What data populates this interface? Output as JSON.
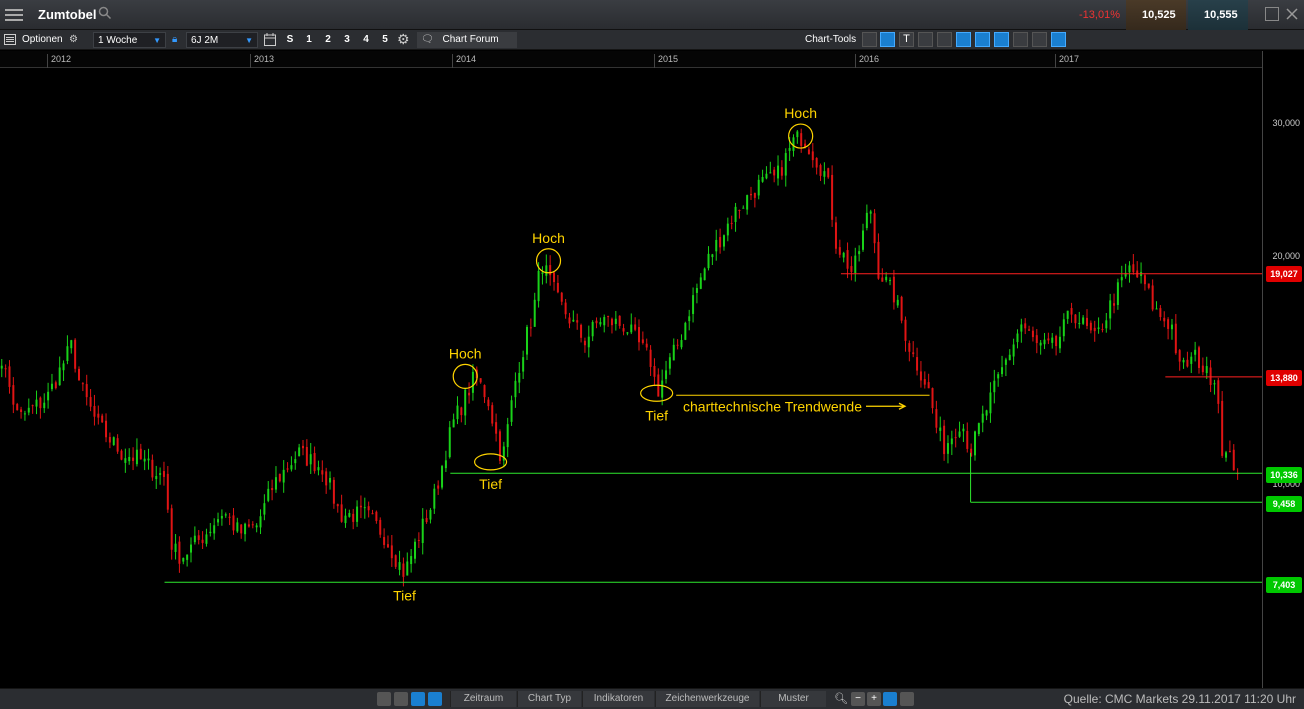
{
  "header": {
    "symbol": "Zumtobel",
    "change_pct": "-13,01%",
    "sell_price": "10,525",
    "buy_price": "10,555"
  },
  "toolbar": {
    "options_label": "Optionen",
    "interval": "1 Woche",
    "range": "6J 2M",
    "s_label": "S",
    "nums": [
      "1",
      "2",
      "3",
      "4",
      "5"
    ],
    "forum_label": "Chart Forum",
    "chart_tools_label": "Chart-Tools"
  },
  "time_axis": {
    "years": [
      "2012",
      "2013",
      "2014",
      "2015",
      "2016",
      "2017"
    ]
  },
  "price_axis": {
    "ticks": [
      "30,000",
      "20,000",
      "10,000"
    ],
    "tags": [
      {
        "label": "19,027",
        "color": "#e00000"
      },
      {
        "label": "13,880",
        "color": "#e00000"
      },
      {
        "label": "10,336",
        "color": "#00c800"
      },
      {
        "label": "9,458",
        "color": "#00c800"
      },
      {
        "label": "7,403",
        "color": "#00c800"
      }
    ]
  },
  "annotations": {
    "hoch": "Hoch",
    "tief": "Tief",
    "trendwende": "charttechnische Trendwende"
  },
  "bottombar": {
    "tabs": [
      "Zeitraum",
      "Chart Typ",
      "Indikatoren",
      "Zeichenwerkzeuge",
      "Muster"
    ],
    "source": "Quelle: CMC Markets 29.11.2017 11:20 Uhr"
  },
  "colors": {
    "up": "#19d219",
    "down": "#e01414",
    "annotation": "#ffd400",
    "support": "#2ee82e",
    "resistance": "#ff2020"
  },
  "chart_data": {
    "type": "candlestick",
    "interval": "1 Woche",
    "x_range": [
      "2011-09",
      "2017-11"
    ],
    "y_scale": "log",
    "ylim": [
      6.4,
      32.2
    ],
    "waypoints": [
      [
        "2011-09-20",
        13.5
      ],
      [
        "2011-10-10",
        14.7
      ],
      [
        "2011-11-10",
        12.2
      ],
      [
        "2012-01-01",
        13.0
      ],
      [
        "2012-02-15",
        15.3
      ],
      [
        "2012-03-01",
        13.5
      ],
      [
        "2012-04-01",
        12.0
      ],
      [
        "2012-05-15",
        11.0
      ],
      [
        "2012-06-15",
        10.8
      ],
      [
        "2012-08-01",
        10.2
      ],
      [
        "2012-08-15",
        8.2
      ],
      [
        "2012-09-01",
        8.0
      ],
      [
        "2012-10-15",
        8.6
      ],
      [
        "2012-11-15",
        9.2
      ],
      [
        "2012-12-15",
        8.6
      ],
      [
        "2013-01-15",
        8.8
      ],
      [
        "2013-02-15",
        10.0
      ],
      [
        "2013-04-01",
        11.0
      ],
      [
        "2013-05-15",
        10.5
      ],
      [
        "2013-06-15",
        9.1
      ],
      [
        "2013-08-01",
        9.1
      ],
      [
        "2013-09-01",
        8.6
      ],
      [
        "2013-10-10",
        7.6
      ],
      [
        "2013-11-01",
        8.4
      ],
      [
        "2013-12-01",
        9.5
      ],
      [
        "2014-01-05",
        12.0
      ],
      [
        "2014-02-15",
        13.9
      ],
      [
        "2014-03-10",
        13.0
      ],
      [
        "2014-04-05",
        10.7
      ],
      [
        "2014-05-01",
        14.0
      ],
      [
        "2014-06-01",
        17.0
      ],
      [
        "2014-06-15",
        19.8
      ],
      [
        "2014-07-15",
        17.5
      ],
      [
        "2014-09-01",
        15.5
      ],
      [
        "2014-10-01",
        16.6
      ],
      [
        "2014-11-15",
        16.2
      ],
      [
        "2015-01-01",
        14.5
      ],
      [
        "2015-01-10",
        13.2
      ],
      [
        "2015-02-20",
        15.5
      ],
      [
        "2015-03-15",
        17.5
      ],
      [
        "2015-04-15",
        20.0
      ],
      [
        "2015-06-01",
        23.0
      ],
      [
        "2015-07-15",
        25.0
      ],
      [
        "2015-08-15",
        25.5
      ],
      [
        "2015-09-15",
        28.5
      ],
      [
        "2015-10-01",
        29.0
      ],
      [
        "2015-10-15",
        28.0
      ],
      [
        "2015-11-15",
        25.5
      ],
      [
        "2015-12-01",
        21.0
      ],
      [
        "2016-01-01",
        19.0
      ],
      [
        "2016-02-01",
        23.5
      ],
      [
        "2016-02-15",
        19.3
      ],
      [
        "2016-03-15",
        17.8
      ],
      [
        "2016-04-15",
        15.0
      ],
      [
        "2016-05-15",
        13.5
      ],
      [
        "2016-06-01",
        11.8
      ],
      [
        "2016-06-15",
        11.2
      ],
      [
        "2016-07-15",
        12.2
      ],
      [
        "2016-08-01",
        11.0
      ],
      [
        "2016-08-15",
        11.8
      ],
      [
        "2016-10-01",
        14.4
      ],
      [
        "2016-11-01",
        16.3
      ],
      [
        "2016-12-01",
        15.2
      ],
      [
        "2017-01-01",
        15.2
      ],
      [
        "2017-02-01",
        17.0
      ],
      [
        "2017-03-15",
        15.5
      ],
      [
        "2017-04-15",
        17.5
      ],
      [
        "2017-05-15",
        19.3
      ],
      [
        "2017-06-10",
        18.6
      ],
      [
        "2017-07-01",
        17.0
      ],
      [
        "2017-08-01",
        16.2
      ],
      [
        "2017-08-15",
        14.2
      ],
      [
        "2017-09-15",
        14.8
      ],
      [
        "2017-10-01",
        14.0
      ],
      [
        "2017-10-20",
        13.9
      ],
      [
        "2017-11-01",
        11.0
      ],
      [
        "2017-11-29",
        10.5
      ]
    ],
    "horizontal_lines": [
      {
        "value": 19.027,
        "from": "2015-12-10",
        "color": "red"
      },
      {
        "value": 13.88,
        "from": "2017-07-20",
        "color": "red"
      },
      {
        "value": 10.336,
        "from": "2014-01-01",
        "color": "green"
      },
      {
        "value": 9.458,
        "from": "2016-08-01",
        "color": "green"
      },
      {
        "value": 7.403,
        "from": "2012-08-01",
        "color": "green"
      }
    ],
    "markers": [
      {
        "label": "Hoch",
        "date": "2014-01-28",
        "value": 13.9
      },
      {
        "label": "Tief",
        "date": "2014-03-15",
        "value": 10.7
      },
      {
        "label": "Hoch",
        "date": "2014-06-28",
        "value": 19.8
      },
      {
        "label": "Tief",
        "date": "2015-01-10",
        "value": 13.2
      },
      {
        "label": "Hoch",
        "date": "2015-09-28",
        "value": 29.0
      },
      {
        "label": "Tief",
        "date": "2013-10-10",
        "value": 7.6
      }
    ],
    "trend_note": {
      "label": "charttechnische Trendwende",
      "date_from": "2015-01-20",
      "date_to": "2016-05-15",
      "value": 13.0
    }
  }
}
